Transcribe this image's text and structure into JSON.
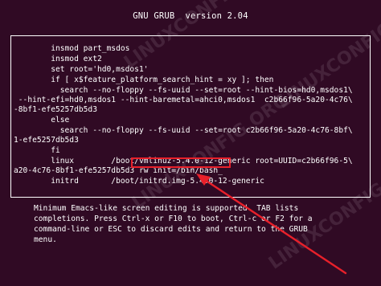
{
  "header": {
    "title": "GNU GRUB  version 2.04"
  },
  "editor": {
    "lines": [
      "        insmod part_msdos",
      "        insmod ext2",
      "        set root='hd0,msdos1'",
      "        if [ x$feature_platform_search_hint = xy ]; then",
      "          search --no-floppy --fs-uuid --set=root --hint-bios=hd0,msdos1\\",
      " --hint-efi=hd0,msdos1 --hint-baremetal=ahci0,msdos1  c2b66f96-5a20-4c76\\",
      "-8bf1-efe5257db5d3",
      "        else",
      "          search --no-floppy --fs-uuid --set=root c2b66f96-5a20-4c76-8bf\\",
      "1-efe5257db5d3",
      "        fi",
      "        linux        /boot/vmlinuz-5.4.0-12-generic root=UUID=c2b66f96-5\\",
      "a20-4c76-8bf1-efe5257db5d3 rw init=/bin/bash_",
      "        initrd       /boot/initrd.img-5.4.0-12-generic"
    ]
  },
  "help": {
    "lines": [
      "Minimum Emacs-like screen editing is supported. TAB lists",
      "completions. Press Ctrl-x or F10 to boot, Ctrl-c or F2 for a",
      "command-line or ESC to discard edits and return to the GRUB",
      "menu."
    ]
  },
  "watermark": {
    "text": "LINUXCONFIG.ORG"
  },
  "colors": {
    "background": "#300a24",
    "foreground": "#ffffff",
    "annotation": "#e8202a"
  }
}
